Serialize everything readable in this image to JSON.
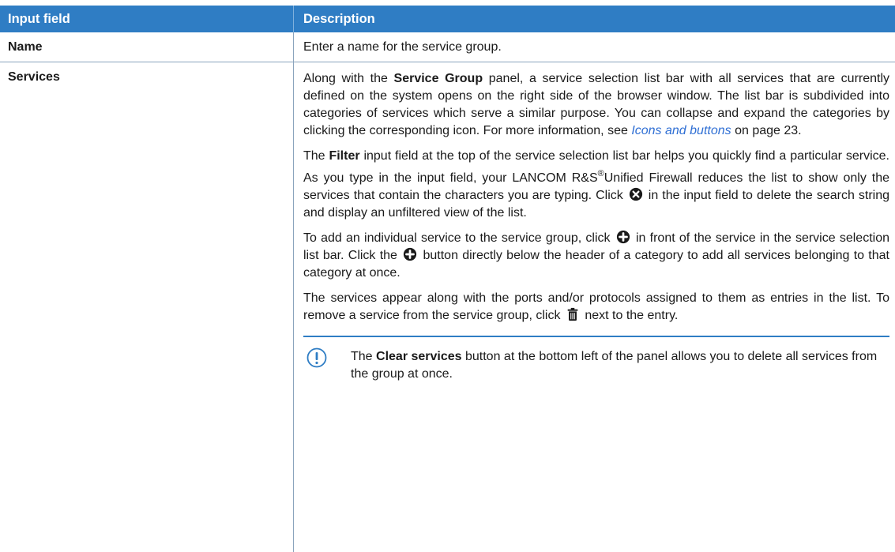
{
  "header": {
    "col1": "Input field",
    "col2": "Description"
  },
  "rows": {
    "name": {
      "field": "Name",
      "description": "Enter a name for the service group."
    },
    "services": {
      "field": "Services",
      "p1": {
        "a": "Along with the ",
        "b": "Service Group",
        "c": " panel, a service selection list bar with all services that are currently defined on the system opens on the right side of the browser window. The list bar is subdivided into categories of services which serve a similar purpose. You can collapse and expand the categories by clicking the corresponding icon. For more information, see ",
        "link": "Icons and buttons",
        "d": " on page 23."
      },
      "p2": {
        "a": "The ",
        "b": "Filter",
        "c": " input field at the top of the service selection list bar helps you quickly find a particular service. As you type in the input field, your LANCOM R&S",
        "reg": "®",
        "d": "Unified Firewall reduces the list to show only the services that contain the characters you are typing. Click ",
        "e": " in the input field to delete the search string and display an unfiltered view of the list."
      },
      "p3": {
        "a": "To add an individual service to the service group, click ",
        "b": " in front of the service in the service selection list bar. Click the ",
        "c": " button directly below the header of a category to add all services belonging to that category at once."
      },
      "p4": {
        "a": "The services appear along with the ports and/or protocols assigned to them as entries in the list. To remove a service from the service group, click ",
        "b": " next to the entry."
      },
      "note": {
        "a": "The ",
        "b": "Clear services",
        "c": " button at the bottom left of the panel allows you to delete all services from the group at once."
      }
    }
  },
  "icons": {
    "clear": "clear-circle-icon",
    "add": "add-circle-icon",
    "delete": "trash-icon",
    "note": "exclamation-circle-icon"
  },
  "colors": {
    "header_bg": "#2f7dc4",
    "link": "#2f6fd4"
  }
}
